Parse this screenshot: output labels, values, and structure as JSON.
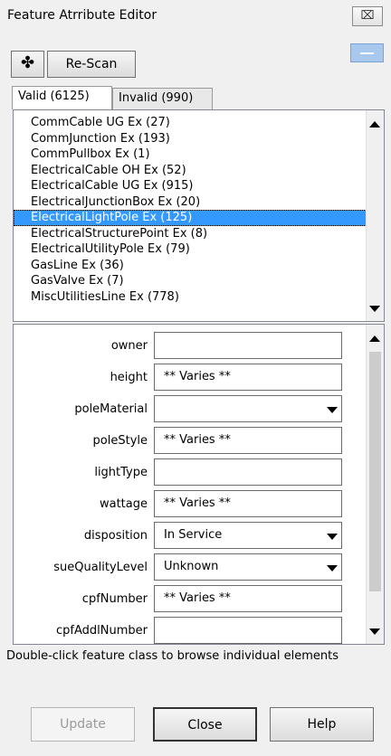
{
  "window": {
    "title": "Feature Atrribute Editor",
    "close_label": "⌧"
  },
  "toolbar": {
    "add_label": "✤",
    "rescan_label": "Re-Scan"
  },
  "tabs": [
    {
      "label": "Valid (6125)",
      "active": true
    },
    {
      "label": "Invalid (990)",
      "active": false
    }
  ],
  "feature_classes": [
    {
      "label": "CommCable UG Ex (27)"
    },
    {
      "label": "CommJunction Ex (193)"
    },
    {
      "label": "CommPullbox Ex (1)"
    },
    {
      "label": "ElectricalCable OH Ex (52)"
    },
    {
      "label": "ElectricalCable UG Ex (915)"
    },
    {
      "label": "ElectricalJunctionBox Ex (20)"
    },
    {
      "label": "ElectricalLightPole Ex (125)",
      "selected": true
    },
    {
      "label": "ElectricalStructurePoint Ex (8)"
    },
    {
      "label": "ElectricalUtilityPole Ex (79)"
    },
    {
      "label": "GasLine Ex (36)"
    },
    {
      "label": "GasValve Ex (7)"
    },
    {
      "label": "MiscUtilitiesLine Ex (778)"
    }
  ],
  "attributes": [
    {
      "name": "owner",
      "value": "",
      "type": "text"
    },
    {
      "name": "height",
      "value": "** Varies **",
      "type": "text"
    },
    {
      "name": "poleMaterial",
      "value": "",
      "type": "dropdown"
    },
    {
      "name": "poleStyle",
      "value": "** Varies **",
      "type": "text"
    },
    {
      "name": "lightType",
      "value": "",
      "type": "text"
    },
    {
      "name": "wattage",
      "value": "** Varies **",
      "type": "text"
    },
    {
      "name": "disposition",
      "value": "In Service",
      "type": "dropdown"
    },
    {
      "name": "sueQualityLevel",
      "value": "Unknown",
      "type": "dropdown"
    },
    {
      "name": "cpfNumber",
      "value": "** Varies **",
      "type": "text"
    },
    {
      "name": "cpfAddlNumber",
      "value": "",
      "type": "text"
    }
  ],
  "hint": "Double-click feature class to browse individual elements",
  "buttons": {
    "update": "Update",
    "close": "Close",
    "help": "Help"
  },
  "colors": {
    "selection": "#3399ff",
    "background": "#f0f0f0"
  }
}
